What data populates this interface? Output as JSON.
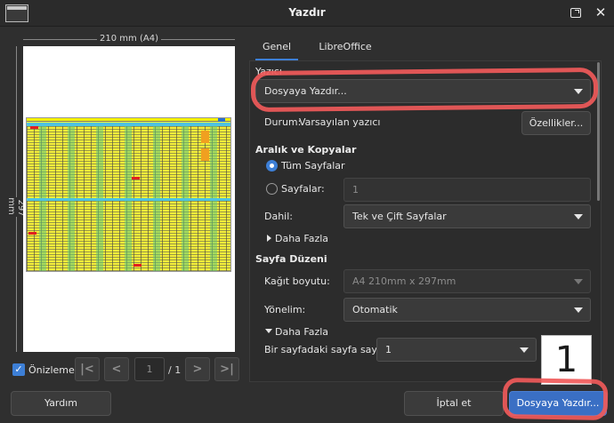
{
  "window": {
    "title": "Yazdır"
  },
  "preview": {
    "paper_width_label": "210 mm (A4)",
    "paper_height_label": "297 mm",
    "preview_checkbox_label": "Önizleme",
    "preview_checked": true,
    "current_page": "1",
    "total_pages": "/ 1",
    "nav_first": "|<",
    "nav_prev": "<",
    "nav_next": ">",
    "nav_last": ">|"
  },
  "tabs": [
    {
      "label": "Genel",
      "active": true
    },
    {
      "label": "LibreOffice Calc",
      "active": false
    }
  ],
  "printer": {
    "section_label": "Yazıcı",
    "selected": "Dosyaya Yazdır...",
    "status_label": "Durum:",
    "status_value": "Varsayılan yazıcı",
    "properties_button": "Özellikler..."
  },
  "range": {
    "section_label": "Aralık ve Kopyalar",
    "all_pages_label": "Tüm Sayfalar",
    "pages_label": "Sayfalar:",
    "pages_value": "1",
    "include_label": "Dahil:",
    "include_value": "Tek ve Çift Sayfalar",
    "more_label": "Daha Fazla"
  },
  "layout": {
    "section_label": "Sayfa Düzeni",
    "paper_size_label": "Kağıt boyutu:",
    "paper_size_value": "A4 210mm x 297mm",
    "orientation_label": "Yönelim:",
    "orientation_value": "Otomatik",
    "more_label": "Daha Fazla",
    "pages_per_sheet_label": "Bir sayfadaki sayfa sayısı:",
    "pages_per_sheet_value": "1",
    "pages_per_sheet_preview": "1"
  },
  "buttons": {
    "help": "Yardım",
    "cancel": "İptal et",
    "print": "Dosyaya Yazdır..."
  },
  "colors": {
    "accent": "#3d7fd6",
    "annotation": "#f05a5a",
    "background": "#2f2f2f"
  }
}
